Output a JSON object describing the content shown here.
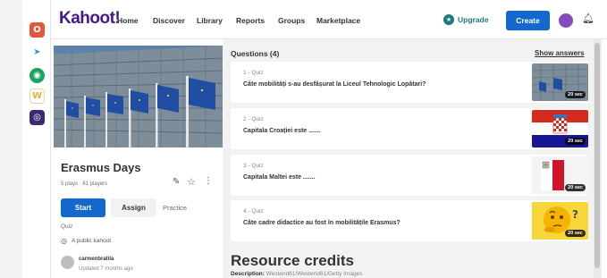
{
  "nav": {
    "logo": "Kahoot!",
    "items": [
      "Home",
      "Discover",
      "Library",
      "Reports",
      "Groups",
      "Marketplace"
    ],
    "upgrade_label": "Upgrade",
    "create_label": "Create"
  },
  "dock": {
    "icons": [
      "office-icon",
      "teacher-tool-icon",
      "chat-icon",
      "word-icon",
      "camera-icon"
    ]
  },
  "kahoot": {
    "title": "Erasmus Days",
    "meta": "5 plays · 61 players",
    "start_label": "Start",
    "assign_label": "Assign",
    "practice_label": "Practice",
    "type_label": "Quiz",
    "visibility": "A public kahoot",
    "creator": "carmenbratila",
    "updated": "Updated 7 months ago"
  },
  "questions": {
    "header": "Questions (4)",
    "show_answers": "Show answers",
    "items": [
      {
        "type": "1 - Quiz",
        "text": "Câte mobilități s-au desfășurat la Liceul Tehnologic Lopătari?",
        "time": "20 sec",
        "thumb": "building-photo"
      },
      {
        "type": "2 - Quiz",
        "text": "Capitala Croației este .......",
        "time": "20 sec",
        "thumb": "croatia-flag"
      },
      {
        "type": "3 - Quiz",
        "text": "Capitala Maltei este .......",
        "time": "20 sec",
        "thumb": "malta-flag"
      },
      {
        "type": "4 - Quiz",
        "text": "Câte cadre didactice au fost în mobilitățile Erasmus?",
        "time": "20 sec",
        "thumb": "thinking-emoji"
      }
    ]
  },
  "credits": {
    "title": "Resource credits",
    "desc_label": "Description:",
    "desc_value": "Westend61/Westend61/Getty Images"
  },
  "colors": {
    "brand": "#46178f",
    "primary": "#1368ce",
    "upgrade": "#1d7a7a"
  }
}
